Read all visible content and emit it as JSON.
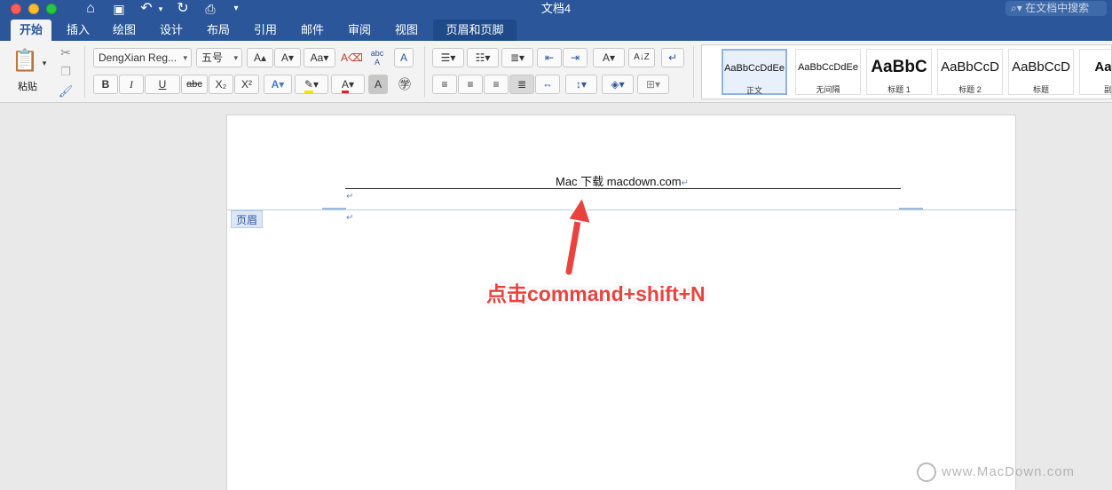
{
  "window": {
    "title": "文档4",
    "search_placeholder": "在文档中搜索"
  },
  "tabs": [
    {
      "label": "开始",
      "active": true
    },
    {
      "label": "插入"
    },
    {
      "label": "绘图"
    },
    {
      "label": "设计"
    },
    {
      "label": "布局"
    },
    {
      "label": "引用"
    },
    {
      "label": "邮件"
    },
    {
      "label": "审阅"
    },
    {
      "label": "视图"
    },
    {
      "label": "页眉和页脚",
      "contextual": true
    }
  ],
  "ribbon": {
    "paste_label": "粘贴",
    "font_name": "DengXian Reg...",
    "font_size": "五号",
    "bold": "B",
    "italic": "I",
    "underline": "U",
    "strikethrough": "abc",
    "subscript": "X₂",
    "superscript": "X²",
    "styles": [
      {
        "preview": "AaBbCcDdEe",
        "label": "正文",
        "active": true
      },
      {
        "preview": "AaBbCcDdEe",
        "label": "无间隔"
      },
      {
        "preview": "AaBbC",
        "label": "标题 1"
      },
      {
        "preview": "AaBbCcD",
        "label": "标题 2"
      },
      {
        "preview": "AaBbCcD",
        "label": "标题"
      },
      {
        "preview": "AaBb",
        "label": "副标"
      }
    ]
  },
  "document": {
    "header_text": "Mac 下载 macdown.com",
    "header_label": "页眉",
    "paragraph_mark": "↵"
  },
  "annotation": {
    "text": "点击command+shift+N"
  },
  "watermark": {
    "text": "www.MacDown.com"
  },
  "colors": {
    "brand": "#2b579a",
    "annotation": "#e9433f"
  }
}
